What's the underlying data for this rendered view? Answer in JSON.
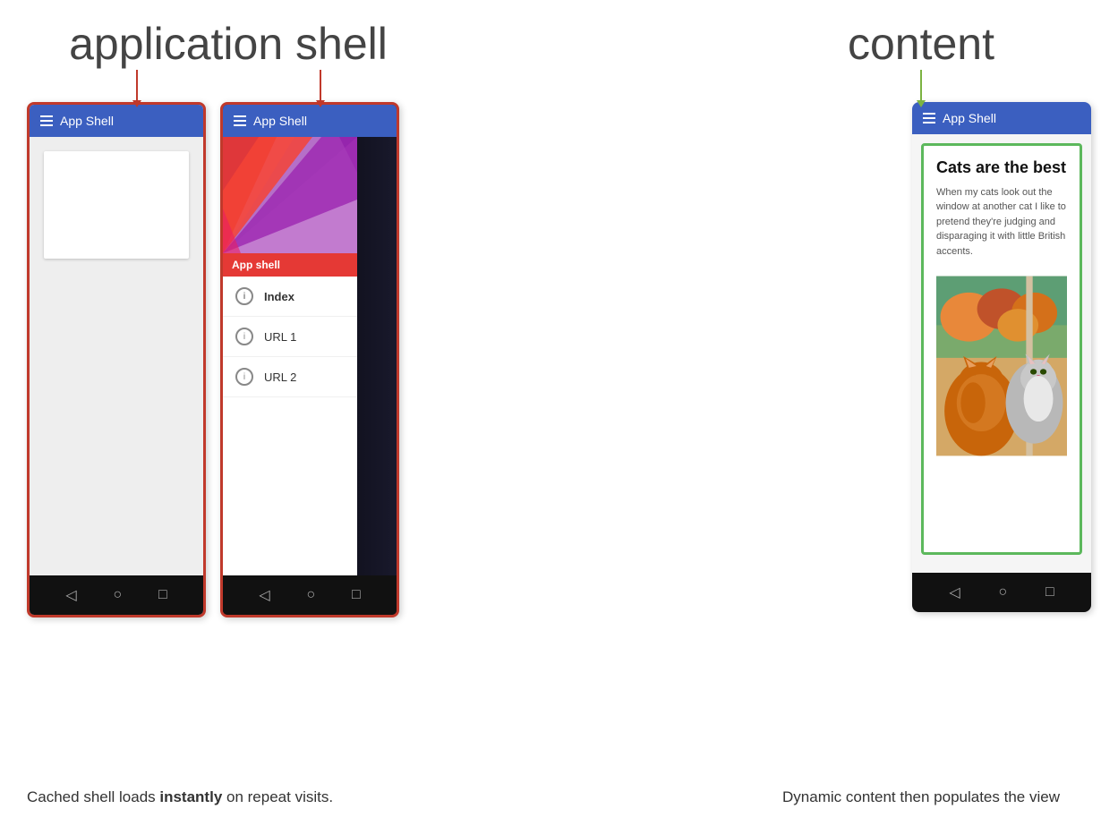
{
  "headings": {
    "application_shell": "application shell",
    "content": "content"
  },
  "phone1": {
    "title": "App Shell",
    "body_placeholder": ""
  },
  "phone2": {
    "title": "App Shell",
    "drawer_app_label": "App shell",
    "items": [
      {
        "label": "Index",
        "active": true
      },
      {
        "label": "URL 1",
        "active": false
      },
      {
        "label": "URL 2",
        "active": false
      }
    ]
  },
  "phone3": {
    "title": "App Shell",
    "content": {
      "title": "Cats are the best",
      "body": "When my cats look out the window at another cat I like to pretend they're judging and disparaging it with little British accents."
    }
  },
  "bottom": {
    "left": "Cached shell loads instantly on repeat visits.",
    "right": "Dynamic content then populates the view"
  },
  "nav_icons": {
    "back": "◁",
    "home": "○",
    "recents": "□"
  }
}
